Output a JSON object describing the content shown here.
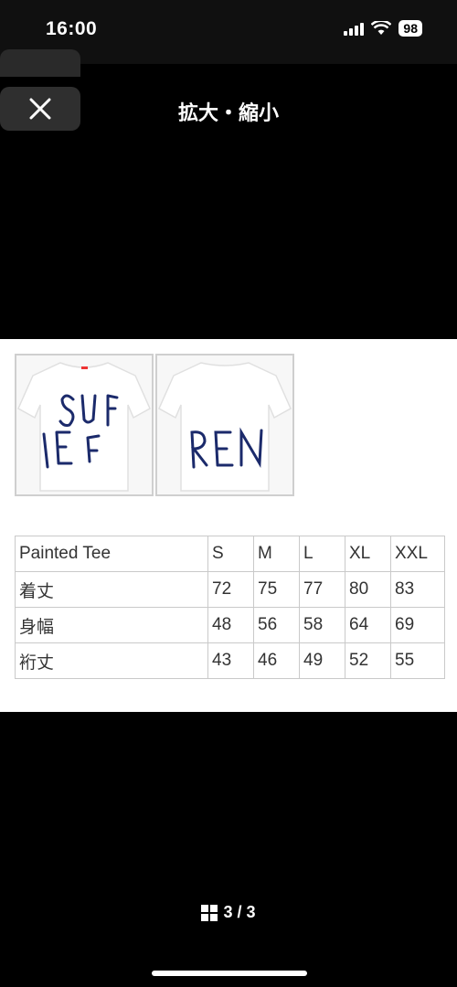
{
  "status_bar": {
    "time": "16:00",
    "battery": "98"
  },
  "header": {
    "title": "拡大・縮小",
    "close_icon": "close-icon"
  },
  "product_images": [
    {
      "alt": "front",
      "letters": [
        "S",
        "U",
        "I",
        "E",
        "F"
      ]
    },
    {
      "alt": "back",
      "letters": [
        "R",
        "E",
        "N"
      ]
    }
  ],
  "size_table": {
    "header": [
      "Painted Tee",
      "S",
      "M",
      "L",
      "XL",
      "XXL"
    ],
    "rows": [
      [
        "着丈",
        "72",
        "75",
        "77",
        "80",
        "83"
      ],
      [
        "身幅",
        "48",
        "56",
        "58",
        "64",
        "69"
      ],
      [
        "裄丈",
        "43",
        "46",
        "49",
        "52",
        "55"
      ]
    ]
  },
  "pager": {
    "icon": "grid-icon",
    "label": "3 / 3"
  },
  "colors": {
    "background": "#000000",
    "panel": "#ffffff",
    "ink": "#1b2a6b"
  }
}
